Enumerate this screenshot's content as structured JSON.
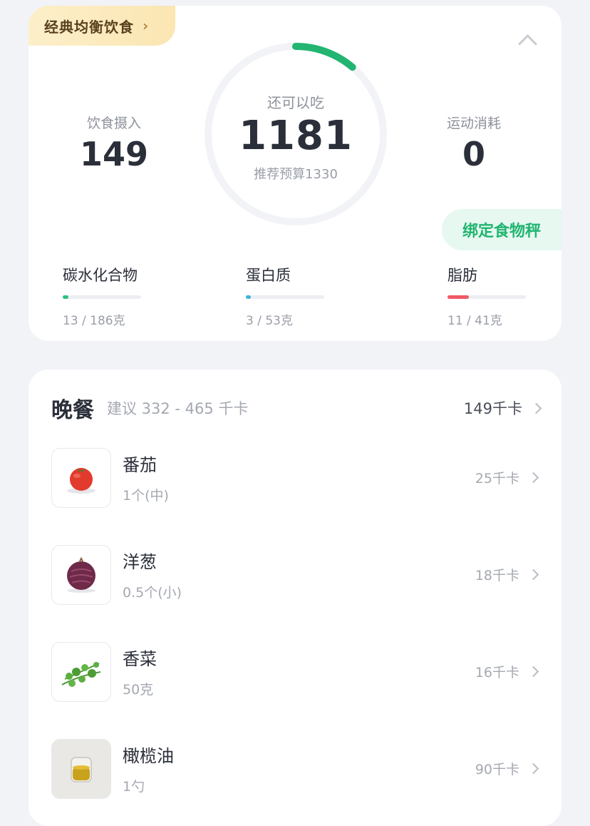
{
  "plan": {
    "label": "经典均衡饮食"
  },
  "summary": {
    "intake": {
      "label": "饮食摄入",
      "value": "149"
    },
    "remaining": {
      "label": "还可以吃",
      "value": "1181",
      "budget": "推荐预算1330"
    },
    "burned": {
      "label": "运动消耗",
      "value": "0"
    },
    "ring_progress": 0.112
  },
  "scale_button": {
    "label": "绑定食物秤"
  },
  "macros": [
    {
      "name": "碳水化合物",
      "amount": "13 / 186克",
      "progress": 0.07,
      "color": "#2fbf7d"
    },
    {
      "name": "蛋白质",
      "amount": "3 / 53克",
      "progress": 0.06,
      "color": "#3bb5d6"
    },
    {
      "name": "脂肪",
      "amount": "11 / 41克",
      "progress": 0.27,
      "color": "#ef5a65"
    }
  ],
  "meal": {
    "title": "晚餐",
    "suggestion": "建议 332 - 465 千卡",
    "total": "149千卡",
    "items": [
      {
        "name": "番茄",
        "portion": "1个(中)",
        "kcal": "25千卡",
        "icon": "tomato-icon"
      },
      {
        "name": "洋葱",
        "portion": "0.5个(小)",
        "kcal": "18千卡",
        "icon": "onion-icon"
      },
      {
        "name": "香菜",
        "portion": "50克",
        "kcal": "16千卡",
        "icon": "coriander-icon"
      },
      {
        "name": "橄榄油",
        "portion": "1勺",
        "kcal": "90千卡",
        "icon": "olive-oil-icon"
      }
    ]
  },
  "colors": {
    "accent_green": "#22b572",
    "ring_track": "#f2f3f7"
  }
}
